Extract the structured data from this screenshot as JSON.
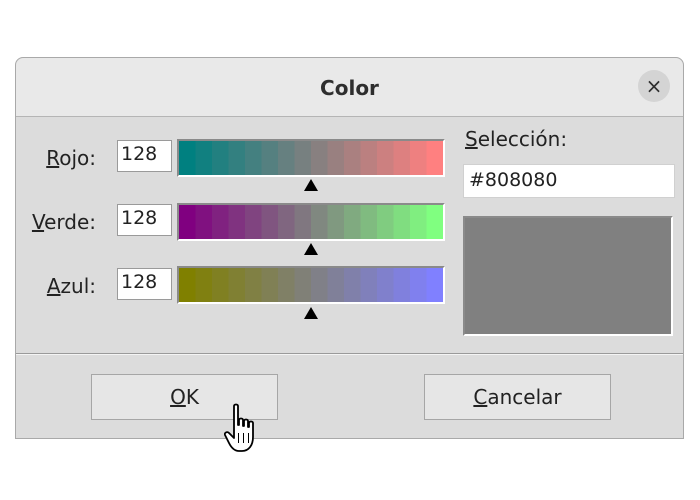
{
  "dialog": {
    "title": "Color",
    "close_glyph": "×"
  },
  "channels": [
    {
      "label_mnemonic": "R",
      "label_rest": "ojo:",
      "value": "128",
      "gradient_start": "#008080",
      "gradient_end": "#ff8080",
      "position": 0.5
    },
    {
      "label_mnemonic": "V",
      "label_rest": "erde:",
      "value": "128",
      "gradient_start": "#800080",
      "gradient_end": "#80ff80",
      "position": 0.5
    },
    {
      "label_mnemonic": "A",
      "label_rest": "zul:",
      "value": "128",
      "gradient_start": "#808000",
      "gradient_end": "#8080ff",
      "position": 0.5
    }
  ],
  "selection": {
    "label_mnemonic": "S",
    "label_rest": "elección:",
    "hex_value": "#808080",
    "preview_color": "#808080"
  },
  "buttons": {
    "ok_mnemonic": "O",
    "ok_rest": "K",
    "cancel_mnemonic": "C",
    "cancel_rest": "ancelar"
  },
  "cursor": {
    "icon": "hand-pointer-icon"
  }
}
